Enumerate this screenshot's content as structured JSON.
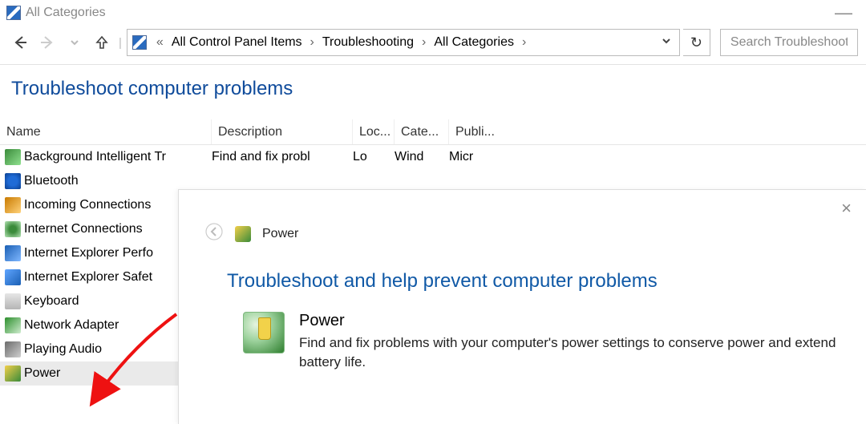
{
  "window": {
    "title": "All Categories"
  },
  "nav": {
    "breadcrumb_prefix": "«",
    "crumbs": [
      "All Control Panel Items",
      "Troubleshooting",
      "All Categories"
    ]
  },
  "search": {
    "placeholder": "Search Troubleshooting"
  },
  "page": {
    "heading": "Troubleshoot computer problems"
  },
  "columns": {
    "name": "Name",
    "description": "Description",
    "location": "Loc...",
    "category": "Cate...",
    "publisher": "Publi..."
  },
  "items": [
    {
      "name": "Background Intelligent Tr",
      "desc": "Find and fix probl",
      "loc": "Lo",
      "cat": "Wind",
      "pub": "Micr",
      "icon": "ic-bits"
    },
    {
      "name": "Bluetooth",
      "icon": "ic-bt"
    },
    {
      "name": "Incoming Connections",
      "icon": "ic-inc"
    },
    {
      "name": "Internet Connections",
      "icon": "ic-int"
    },
    {
      "name": "Internet Explorer Perfo",
      "icon": "ic-iep"
    },
    {
      "name": "Internet Explorer Safet",
      "icon": "ic-ies"
    },
    {
      "name": "Keyboard",
      "icon": "ic-kb"
    },
    {
      "name": "Network Adapter",
      "icon": "ic-net"
    },
    {
      "name": "Playing Audio",
      "icon": "ic-aud"
    },
    {
      "name": "Power",
      "icon": "ic-pwr",
      "selected": true
    }
  ],
  "wizard": {
    "header_title": "Power",
    "heading": "Troubleshoot and help prevent computer problems",
    "item_title": "Power",
    "item_desc": "Find and fix problems with your computer's power settings to conserve power and extend battery life."
  }
}
